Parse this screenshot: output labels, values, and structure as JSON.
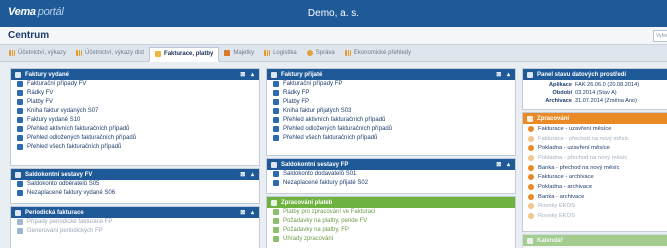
{
  "topbar": {
    "brand": "Vema",
    "brand_suffix": "portál",
    "company": "Demo, a. s."
  },
  "app": {
    "title": "Centrum",
    "search_placeholder": "Vyhle"
  },
  "tabs": [
    {
      "label": "Účetnictví, výkazy",
      "active": false
    },
    {
      "label": "Účetnictví, výkazy dist",
      "active": false
    },
    {
      "label": "Fakturace, platby",
      "active": true
    },
    {
      "label": "Majetky",
      "active": false
    },
    {
      "label": "Logistika",
      "active": false
    },
    {
      "label": "Správa",
      "active": false
    },
    {
      "label": "Ekonomické přehledy",
      "active": false
    }
  ],
  "panels": {
    "faktury_vydane": {
      "title": "Faktury vydané",
      "items": [
        "Fakturační případy FV",
        "Řádky FV",
        "Platby FV",
        "Kniha faktur vydaných S07",
        "Faktury vydané S10",
        "Přehled aktivních fakturačních případů",
        "Přehled odložených fakturačních případů",
        "Přehled všech fakturačních případů"
      ]
    },
    "saldokonto_fv": {
      "title": "Saldokontní sestavy FV",
      "items": [
        "Saldokonto odběratelů S05",
        "Nezaplacené faktury vydané S06"
      ]
    },
    "periodicka": {
      "title": "Periodická fakturace",
      "items": [
        "Případy periodické fakturace FP",
        "Generování periodických FP"
      ]
    },
    "faktury_prijate": {
      "title": "Faktury přijaté",
      "items": [
        "Fakturační případy FP",
        "Řádky FP",
        "Platby FP",
        "Kniha faktur přijatých S03",
        "Přehled aktivních fakturačních případů",
        "Přehled odložených fakturačních případů",
        "Přehled všech fakturačních případů"
      ]
    },
    "saldokonto_fp": {
      "title": "Saldokontní sestavy FP",
      "items": [
        "Saldokonto dodavatelů S01",
        "Nezaplacené faktury přijaté S02"
      ]
    },
    "zpracovani_plateb": {
      "title": "Zpracování plateb",
      "items": [
        "Platby pro zpracování ve Fakturaci",
        "Požadavky na platby, pende FV",
        "Požadavky na platby, FP",
        "Úhrady zpracování"
      ]
    },
    "panel_datovych": {
      "title": "Panel stavu datových prostředí",
      "rows": [
        {
          "key": "Aplikace",
          "value": "FAK 26.06.0 (20.08.2014)"
        },
        {
          "key": "Období",
          "value": "03.2014 (Stav A)"
        },
        {
          "key": "Archivace",
          "value": "31.07.2014 (Změna Ano)"
        }
      ]
    },
    "zpracovani": {
      "title": "Zpracování",
      "items": [
        {
          "label": "Fakturace - uzavření měsíce",
          "faded": false
        },
        {
          "label": "Fakturace - přechod na nový měsíc",
          "faded": true
        },
        {
          "label": "Pokladna - uzavření měsíce",
          "faded": false
        },
        {
          "label": "Pokladna - přechod na nový měsíc",
          "faded": true
        },
        {
          "label": "Banka - přechod na nový měsíc",
          "faded": false
        },
        {
          "label": "Fakturace - archivace",
          "faded": false
        },
        {
          "label": "Pokladna - archivace",
          "faded": false
        },
        {
          "label": "Banka - archivace",
          "faded": false
        },
        {
          "label": "Rovnky EKOS",
          "faded": true
        },
        {
          "label": "Rovnky EKOS",
          "faded": true
        }
      ]
    },
    "kalendar": {
      "title": "Kalendář"
    }
  },
  "controls": {
    "panel": "⊠ ▴"
  }
}
